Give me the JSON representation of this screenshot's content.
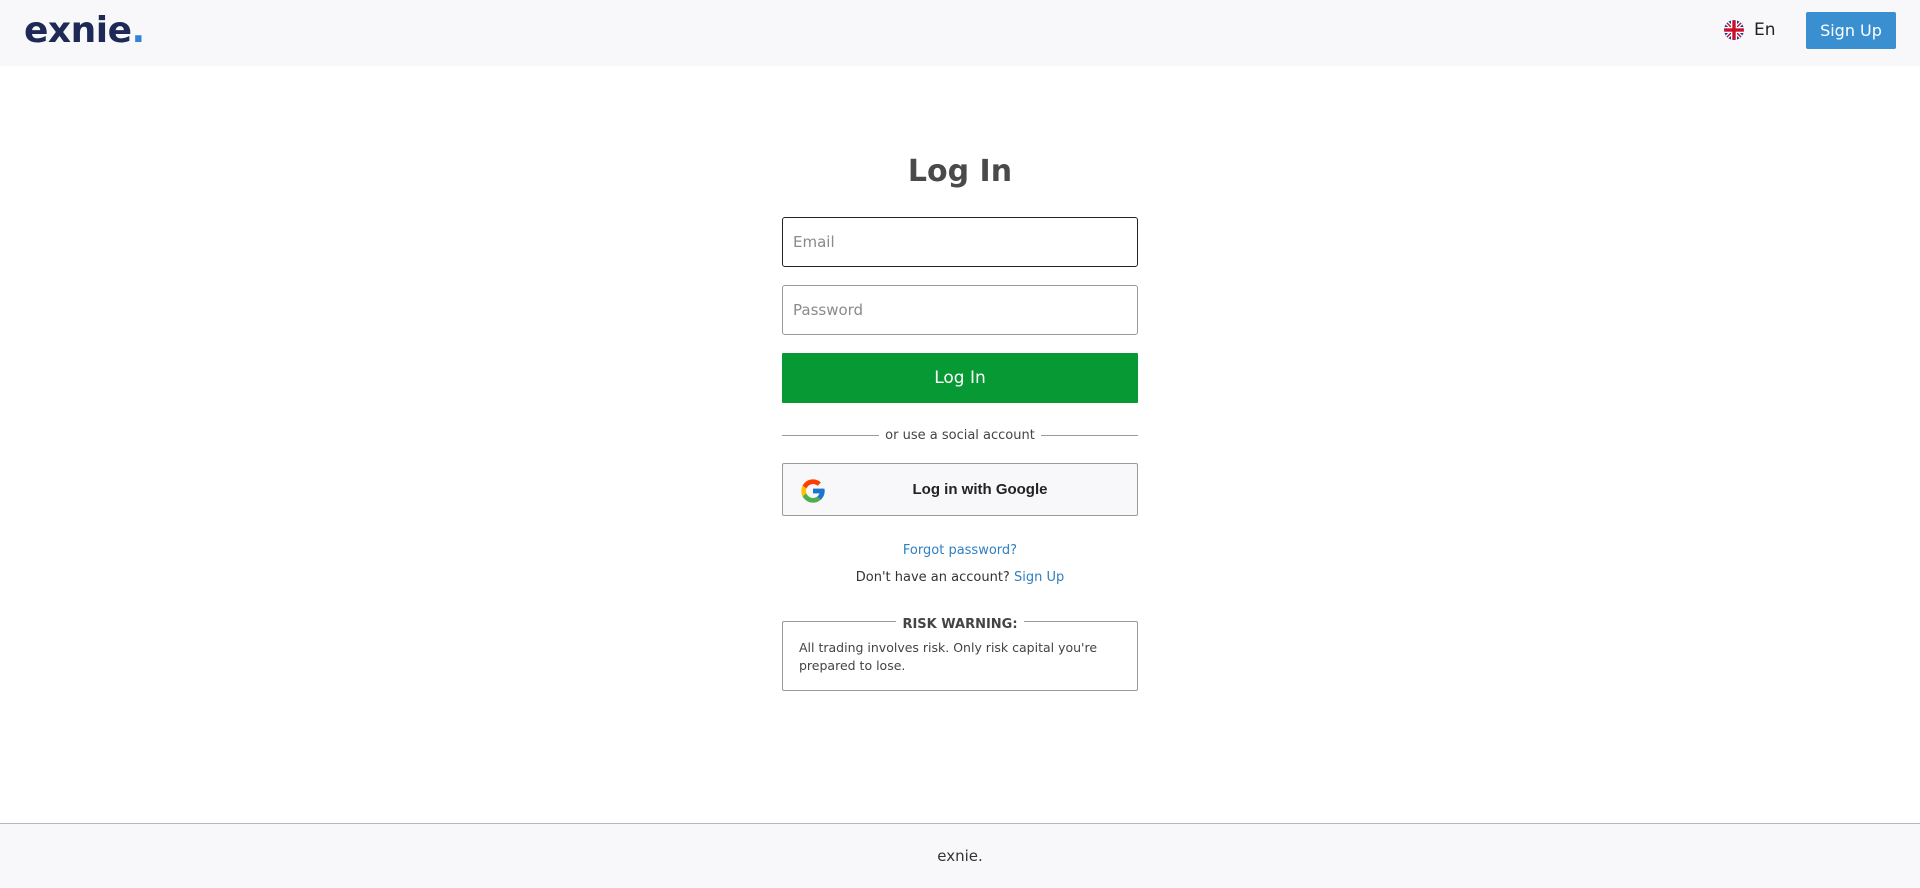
{
  "header": {
    "logo_text": "exnie",
    "logo_dot": ".",
    "language": "En",
    "signup_label": "Sign Up"
  },
  "form": {
    "title": "Log In",
    "email_placeholder": "Email",
    "password_placeholder": "Password",
    "login_label": "Log In",
    "divider_text": "or use a social account",
    "google_label": "Log in with Google",
    "forgot_label": "Forgot password?",
    "no_account_text": "Don't have an account?",
    "signup_link": "Sign Up"
  },
  "risk": {
    "title": "RISK WARNING:",
    "text": "All trading involves risk. Only risk capital you're prepared to lose."
  },
  "footer": {
    "text": "exnie."
  },
  "colors": {
    "accent_blue": "#3a8fd0",
    "login_green": "#079a34",
    "logo_navy": "#1e2a55",
    "link_blue": "#2f7fc1"
  },
  "icons": {
    "flag": "uk-flag-icon",
    "google": "google-icon"
  }
}
